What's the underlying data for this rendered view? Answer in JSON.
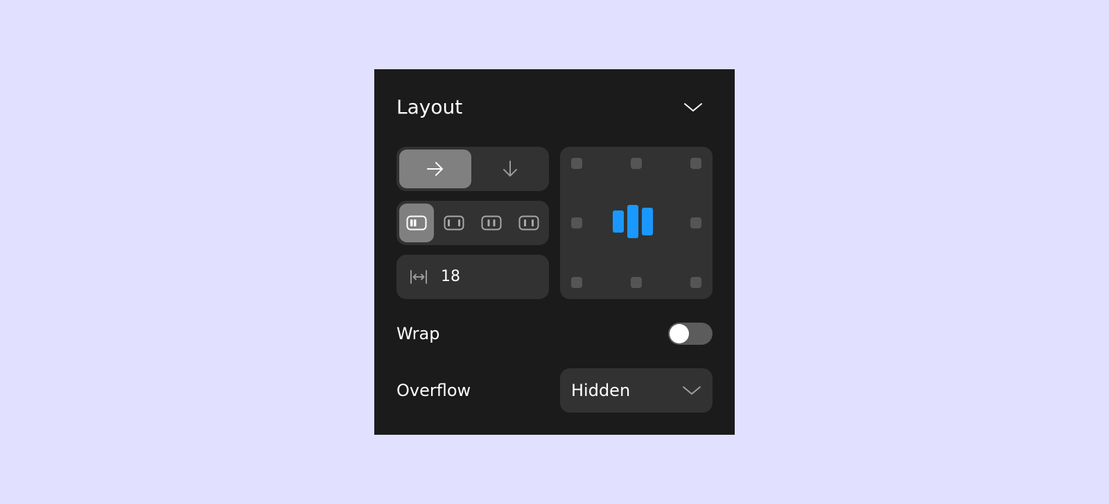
{
  "panel": {
    "title": "Layout",
    "collapse_icon": "chevron-down-icon"
  },
  "direction": {
    "options": [
      {
        "icon": "arrow-right-icon",
        "selected": true
      },
      {
        "icon": "arrow-down-icon",
        "selected": false
      }
    ]
  },
  "justify": {
    "options": [
      {
        "icon": "justify-start-icon",
        "selected": true
      },
      {
        "icon": "justify-center-icon",
        "selected": false
      },
      {
        "icon": "justify-space-between-icon",
        "selected": false
      },
      {
        "icon": "justify-space-around-icon",
        "selected": false
      }
    ]
  },
  "gap": {
    "icon": "horizontal-gap-icon",
    "value": "18"
  },
  "alignment": {
    "selected": "center-center",
    "preview_icon": "align-center-bars-icon"
  },
  "wrap": {
    "label": "Wrap",
    "enabled": false
  },
  "overflow": {
    "label": "Overflow",
    "value": "Hidden",
    "icon": "chevron-down-icon"
  },
  "colors": {
    "background": "#e2e0ff",
    "panel": "#1b1b1b",
    "control": "#323232",
    "active": "#808080",
    "accent": "#1a98ff"
  }
}
